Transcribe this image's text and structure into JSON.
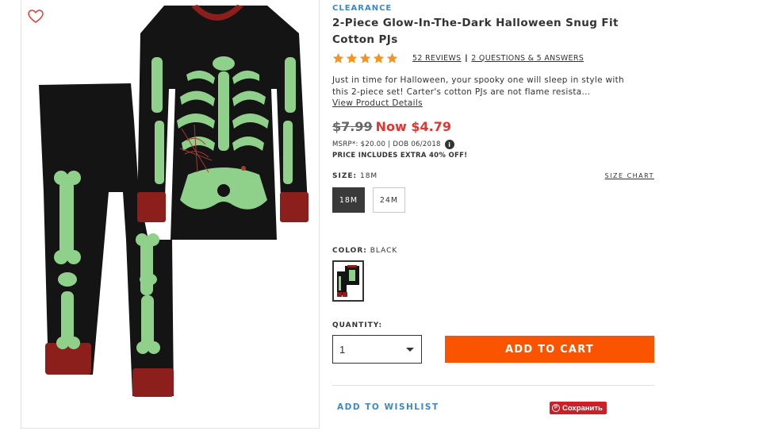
{
  "product": {
    "badge": "CLEARANCE",
    "title": "2-Piece Glow-In-The-Dark Halloween Snug Fit Cotton PJs",
    "rating": 5,
    "reviews_link": "52 REVIEWS",
    "separator": "|",
    "questions_link": "2 QUESTIONS & 5 ANSWERS",
    "description": "Just in time for Halloween, your spooky one will sleep in style with this 2-piece set! Carter's cotton PJs are not flame resista...",
    "view_details": "View Product Details"
  },
  "pricing": {
    "old_price": "$7.99",
    "now_price": "Now $4.79",
    "msrp": "MSRP*: $20.00 | DOB 06/2018",
    "info_icon": "i",
    "promo": "PRICE INCLUDES EXTRA 40% OFF!"
  },
  "size": {
    "label": "SIZE:",
    "selected": "18M",
    "chart_link": "SIZE CHART",
    "options": [
      "18M",
      "24M"
    ]
  },
  "color": {
    "label": "COLOR:",
    "selected": "BLACK"
  },
  "quantity": {
    "label": "QUANTITY:",
    "value": "1"
  },
  "actions": {
    "add_to_cart": "ADD TO CART",
    "wishlist": "ADD TO WISHLIST",
    "pinterest_save": "Сохранить"
  },
  "icons": {
    "favorite": "heart-outline-icon",
    "star": "star-icon",
    "dropdown": "caret-down-icon",
    "pinterest": "pinterest-icon"
  },
  "colors": {
    "accent_blue": "#3c88c7",
    "sale_red": "#e8332f",
    "cart_orange": "#fa5400",
    "star_orange": "#f7941d",
    "pinterest_red": "#cb2027",
    "garment_black": "#141414",
    "garment_glow": "#8fd18a",
    "garment_cuff": "#8c1f1c"
  }
}
